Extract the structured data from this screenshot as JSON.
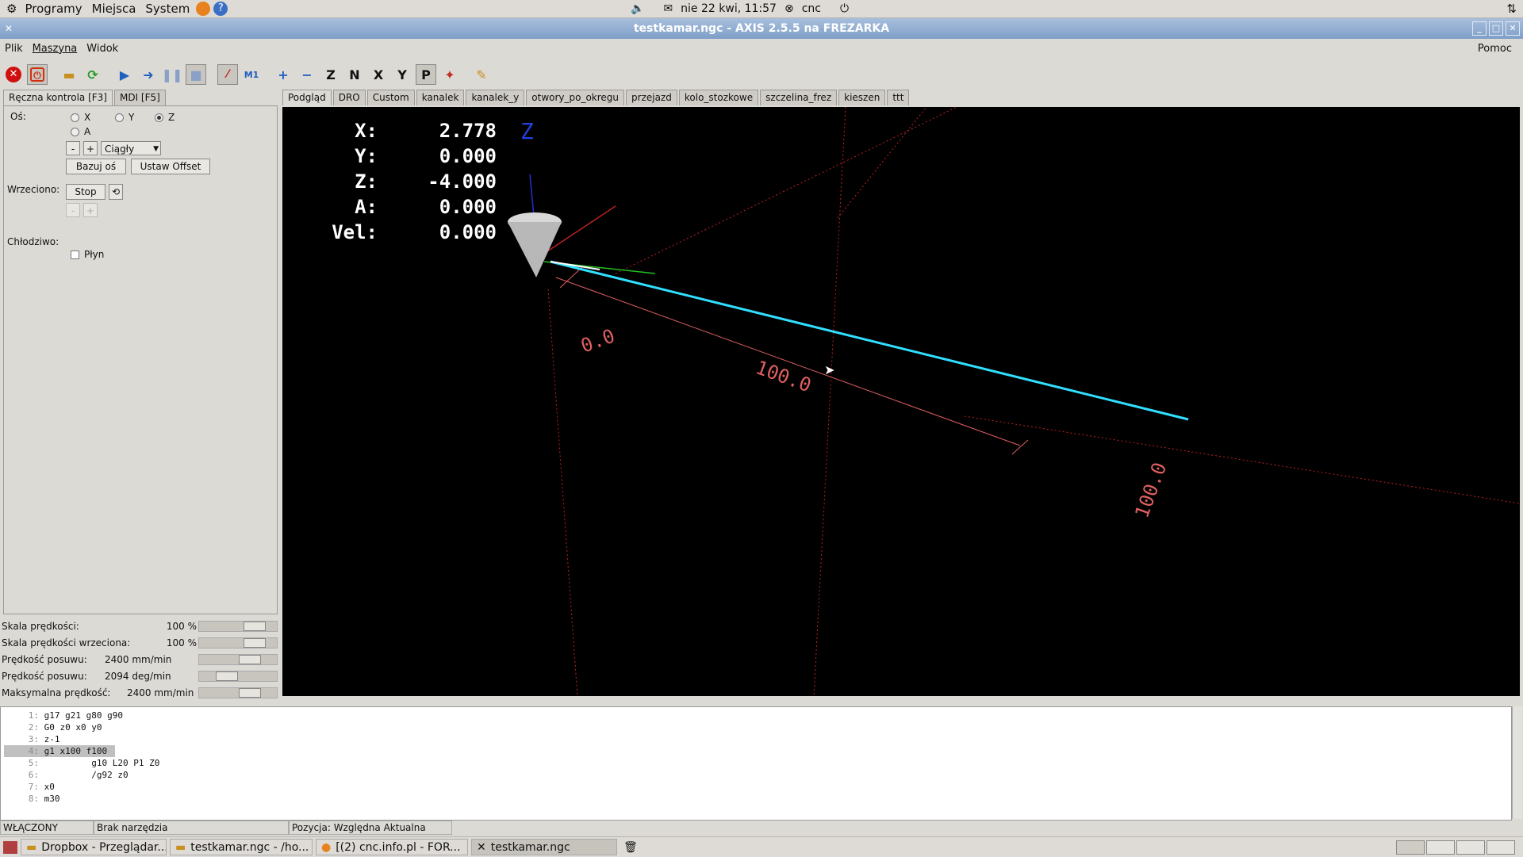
{
  "panel": {
    "menus": [
      "Programy",
      "Miejsca",
      "System"
    ],
    "datetime": "nie 22 kwi, 11:57",
    "user": "cnc"
  },
  "window": {
    "title": "testkamar.ngc - AXIS 2.5.5 na FREZARKA"
  },
  "menubar": {
    "items": [
      "Plik",
      "Maszyna",
      "Widok"
    ],
    "help": "Pomoc"
  },
  "toolbar": {
    "icons": [
      "estop-icon",
      "power-icon",
      "open-file-icon",
      "reload-icon",
      "run-icon",
      "step-icon",
      "pause-icon",
      "stop-icon",
      "block-delete-icon",
      "optional-stop-icon",
      "zoom-in-icon",
      "zoom-out-icon",
      "view-z-icon",
      "view-z2-icon",
      "view-x-icon",
      "view-y-icon",
      "view-p-icon",
      "rotate-icon",
      "clear-plot-icon"
    ],
    "labels": [
      "",
      "",
      "",
      "",
      "",
      "",
      "",
      "",
      "",
      "",
      "+",
      "−",
      "Z",
      "N",
      "X",
      "Y",
      "P",
      "",
      ""
    ]
  },
  "left": {
    "tabs": [
      "Ręczna kontrola [F3]",
      "MDI [F5]"
    ],
    "axis_label": "Oś:",
    "axes": [
      "X",
      "Y",
      "Z",
      "A"
    ],
    "selected_axis": "Z",
    "minus": "-",
    "plus": "+",
    "jog_mode": "Ciągły",
    "home_button": "Bazuj oś",
    "offset_button": "Ustaw Offset",
    "spindle_label": "Wrzeciono:",
    "spindle_stop": "Stop",
    "coolant_label": "Chłodziwo:",
    "flood": "Płyn"
  },
  "sliders": [
    {
      "name": "Skala prędkości:",
      "value": "100 %",
      "fraction": 0.8
    },
    {
      "name": "Skala prędkości wrzeciona:",
      "value": "100 %",
      "fraction": 0.8
    },
    {
      "name": "Prędkość posuwu:",
      "value": "2400 mm/min",
      "fraction": 0.72
    },
    {
      "name": "Prędkość posuwu:",
      "value": "2094 deg/min",
      "fraction": 0.3
    },
    {
      "name": "Maksymalna prędkość:",
      "value": "2400 mm/min",
      "fraction": 0.72
    }
  ],
  "preview": {
    "tabs": [
      "Podgląd",
      "DRO",
      "Custom",
      "kanalek",
      "kanalek_y",
      "otwory_po_okregu",
      "przejazd",
      "kolo_stozkowe",
      "szczelina_frez",
      "kieszen",
      "ttt"
    ],
    "dro": [
      {
        "axis": "X:",
        "value": "2.778"
      },
      {
        "axis": "Y:",
        "value": "0.000"
      },
      {
        "axis": "Z:",
        "value": "-4.000"
      },
      {
        "axis": "A:",
        "value": "0.000"
      },
      {
        "axis": "Vel:",
        "value": "0.000"
      }
    ],
    "labels": {
      "origin": "0.0",
      "xlen": "100.0",
      "ylen": "100.0",
      "z": "Z"
    }
  },
  "code": [
    {
      "n": "1:",
      "text": "g17 g21 g80 g90"
    },
    {
      "n": "2:",
      "text": "G0 z0 x0 y0"
    },
    {
      "n": "3:",
      "text": "z-1"
    },
    {
      "n": "4:",
      "text": "g1 x100 f100"
    },
    {
      "n": "5:",
      "text": "         g10 L20 P1 Z0"
    },
    {
      "n": "6:",
      "text": "         /g92 z0"
    },
    {
      "n": "7:",
      "text": "x0"
    },
    {
      "n": "8:",
      "text": "m30"
    }
  ],
  "status": {
    "machine": "WŁĄCZONY",
    "tool": "Brak narzędzia",
    "position": "Pozycja: Względna Aktualna"
  },
  "taskbar": [
    {
      "label": "Dropbox - Przeglądar...",
      "active": false
    },
    {
      "label": "testkamar.ngc - /ho...",
      "active": false
    },
    {
      "label": "[(2) cnc.info.pl - FOR...",
      "active": false
    },
    {
      "label": "testkamar.ngc",
      "active": true
    }
  ]
}
